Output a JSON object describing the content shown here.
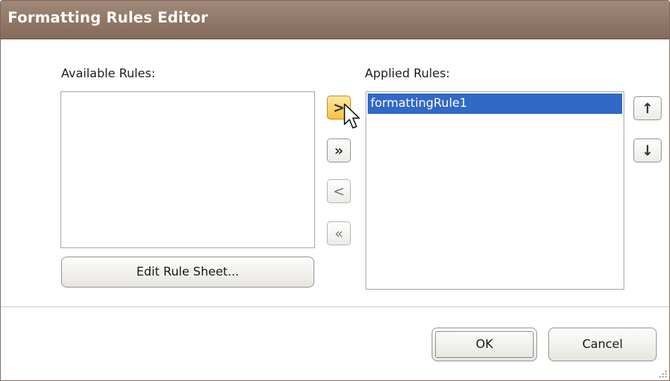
{
  "window": {
    "title": "Formatting Rules Editor"
  },
  "available": {
    "label": "Available Rules:",
    "items": []
  },
  "applied": {
    "label": "Applied Rules:",
    "items": [
      "formattingRule1"
    ],
    "selected_index": 0
  },
  "buttons": {
    "move_right": ">",
    "move_all_right": "»",
    "move_left": "<",
    "move_all_left": "«",
    "move_up": "↑",
    "move_down": "↓",
    "edit_rule_sheet": "Edit Rule Sheet...",
    "ok": "OK",
    "cancel": "Cancel"
  },
  "colors": {
    "title_bar": "#937a6a",
    "selection": "#3169c6",
    "hot_button": "#f7c23f"
  }
}
